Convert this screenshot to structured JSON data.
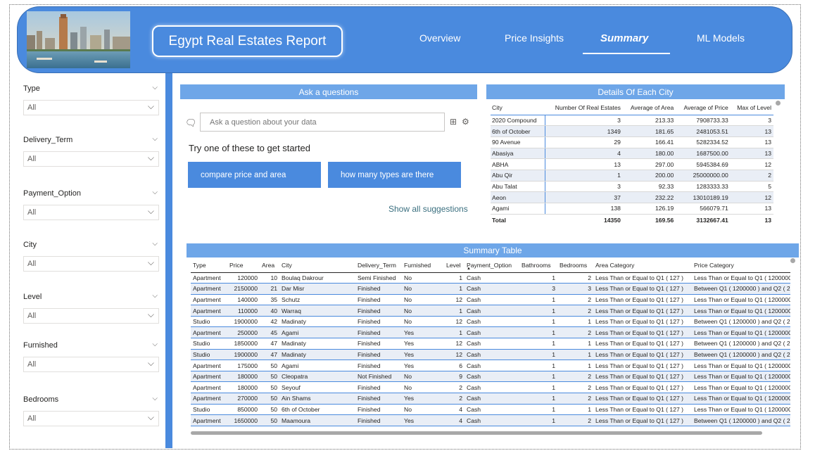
{
  "header": {
    "report_title": "Egypt Real Estates Report",
    "nav": [
      "Overview",
      "Price Insights",
      "Summary",
      "ML Models"
    ],
    "active_nav": "Summary"
  },
  "filters": [
    {
      "label": "Type",
      "value": "All"
    },
    {
      "label": "Delivery_Term",
      "value": "All"
    },
    {
      "label": "Payment_Option",
      "value": "All"
    },
    {
      "label": "City",
      "value": "All"
    },
    {
      "label": "Level",
      "value": "All"
    },
    {
      "label": "Furnished",
      "value": "All"
    },
    {
      "label": "Bedrooms",
      "value": "All"
    }
  ],
  "qa": {
    "title": "Ask a questions",
    "placeholder": "Ask a question about your data",
    "try_text": "Try one of these to get started",
    "suggestions": [
      "compare price and area",
      "how many types are there"
    ],
    "show_all": "Show all suggestions"
  },
  "city_table": {
    "title": "Details Of Each City",
    "columns": [
      "City",
      "Number Of Real Estates",
      "Average of Area",
      "Average of Price",
      "Max of Level"
    ],
    "rows": [
      [
        "2020 Compound",
        "3",
        "213.33",
        "7908733.33",
        "3"
      ],
      [
        "6th of October",
        "1349",
        "181.65",
        "2481053.51",
        "13"
      ],
      [
        "90 Avenue",
        "29",
        "166.41",
        "5282334.52",
        "13"
      ],
      [
        "Abasiya",
        "4",
        "180.00",
        "1687500.00",
        "13"
      ],
      [
        "ABHA",
        "13",
        "297.00",
        "5945384.69",
        "12"
      ],
      [
        "Abu Qir",
        "1",
        "200.00",
        "25000000.00",
        "2"
      ],
      [
        "Abu Talat",
        "3",
        "92.33",
        "1283333.33",
        "5"
      ],
      [
        "Aeon",
        "37",
        "232.22",
        "13010189.19",
        "12"
      ],
      [
        "Agami",
        "138",
        "126.19",
        "566079.71",
        "13"
      ]
    ],
    "total": [
      "Total",
      "14350",
      "169.56",
      "3132667.41",
      "13"
    ]
  },
  "summary_table": {
    "title": "Summary Table",
    "columns": [
      "Type",
      "Price",
      "Area",
      "City",
      "Delivery_Term",
      "Furnished",
      "Level",
      "Payment_Option",
      "Bathrooms",
      "Bedrooms",
      "Area Category",
      "Price Category"
    ],
    "rows": [
      [
        "Apartment",
        "120000",
        "10",
        "Boulaq Dakrour",
        "Semi Finished",
        "No",
        "1",
        "Cash",
        "1",
        "2",
        "Less Than or Equal to Q1 ( 127 )",
        "Less Than or Equal to Q1 ( 1200000 )"
      ],
      [
        "Apartment",
        "2150000",
        "21",
        "Dar Misr",
        "Finished",
        "No",
        "1",
        "Cash",
        "3",
        "3",
        "Less Than or Equal to Q1 ( 127 )",
        "Between Q1 ( 1200000 ) and Q2 ( 2"
      ],
      [
        "Apartment",
        "140000",
        "35",
        "Schutz",
        "Finished",
        "No",
        "12",
        "Cash",
        "1",
        "2",
        "Less Than or Equal to Q1 ( 127 )",
        "Less Than or Equal to Q1 ( 1200000 )"
      ],
      [
        "Apartment",
        "110000",
        "40",
        "Warraq",
        "Finished",
        "No",
        "1",
        "Cash",
        "1",
        "2",
        "Less Than or Equal to Q1 ( 127 )",
        "Less Than or Equal to Q1 ( 1200000 )"
      ],
      [
        "Studio",
        "1900000",
        "42",
        "Madinaty",
        "Finished",
        "No",
        "12",
        "Cash",
        "1",
        "1",
        "Less Than or Equal to Q1 ( 127 )",
        "Between Q1 ( 1200000 ) and Q2 ( 2"
      ],
      [
        "Apartment",
        "250000",
        "45",
        "Agami",
        "Finished",
        "Yes",
        "1",
        "Cash",
        "1",
        "2",
        "Less Than or Equal to Q1 ( 127 )",
        "Less Than or Equal to Q1 ( 1200000 )"
      ],
      [
        "Studio",
        "1850000",
        "47",
        "Madinaty",
        "Finished",
        "Yes",
        "12",
        "Cash",
        "1",
        "1",
        "Less Than or Equal to Q1 ( 127 )",
        "Between Q1 ( 1200000 ) and Q2 ( 2"
      ],
      [
        "Studio",
        "1900000",
        "47",
        "Madinaty",
        "Finished",
        "Yes",
        "12",
        "Cash",
        "1",
        "1",
        "Less Than or Equal to Q1 ( 127 )",
        "Between Q1 ( 1200000 ) and Q2 ( 2"
      ],
      [
        "Apartment",
        "175000",
        "50",
        "Agami",
        "Finished",
        "Yes",
        "6",
        "Cash",
        "1",
        "1",
        "Less Than or Equal to Q1 ( 127 )",
        "Less Than or Equal to Q1 ( 1200000 )"
      ],
      [
        "Apartment",
        "180000",
        "50",
        "Cleopatra",
        "Not Finished",
        "No",
        "9",
        "Cash",
        "1",
        "2",
        "Less Than or Equal to Q1 ( 127 )",
        "Less Than or Equal to Q1 ( 1200000 )"
      ],
      [
        "Apartment",
        "180000",
        "50",
        "Seyouf",
        "Finished",
        "No",
        "2",
        "Cash",
        "1",
        "2",
        "Less Than or Equal to Q1 ( 127 )",
        "Less Than or Equal to Q1 ( 1200000 )"
      ],
      [
        "Apartment",
        "270000",
        "50",
        "Ain Shams",
        "Finished",
        "Yes",
        "2",
        "Cash",
        "1",
        "2",
        "Less Than or Equal to Q1 ( 127 )",
        "Less Than or Equal to Q1 ( 1200000 )"
      ],
      [
        "Studio",
        "850000",
        "50",
        "6th of October",
        "Finished",
        "No",
        "4",
        "Cash",
        "1",
        "1",
        "Less Than or Equal to Q1 ( 127 )",
        "Less Than or Equal to Q1 ( 1200000 )"
      ],
      [
        "Apartment",
        "1650000",
        "50",
        "Maamoura",
        "Finished",
        "Yes",
        "4",
        "Cash",
        "1",
        "2",
        "Less Than or Equal to Q1 ( 127 )",
        "Between Q1 ( 1200000 ) and Q2 ( 2"
      ]
    ]
  }
}
